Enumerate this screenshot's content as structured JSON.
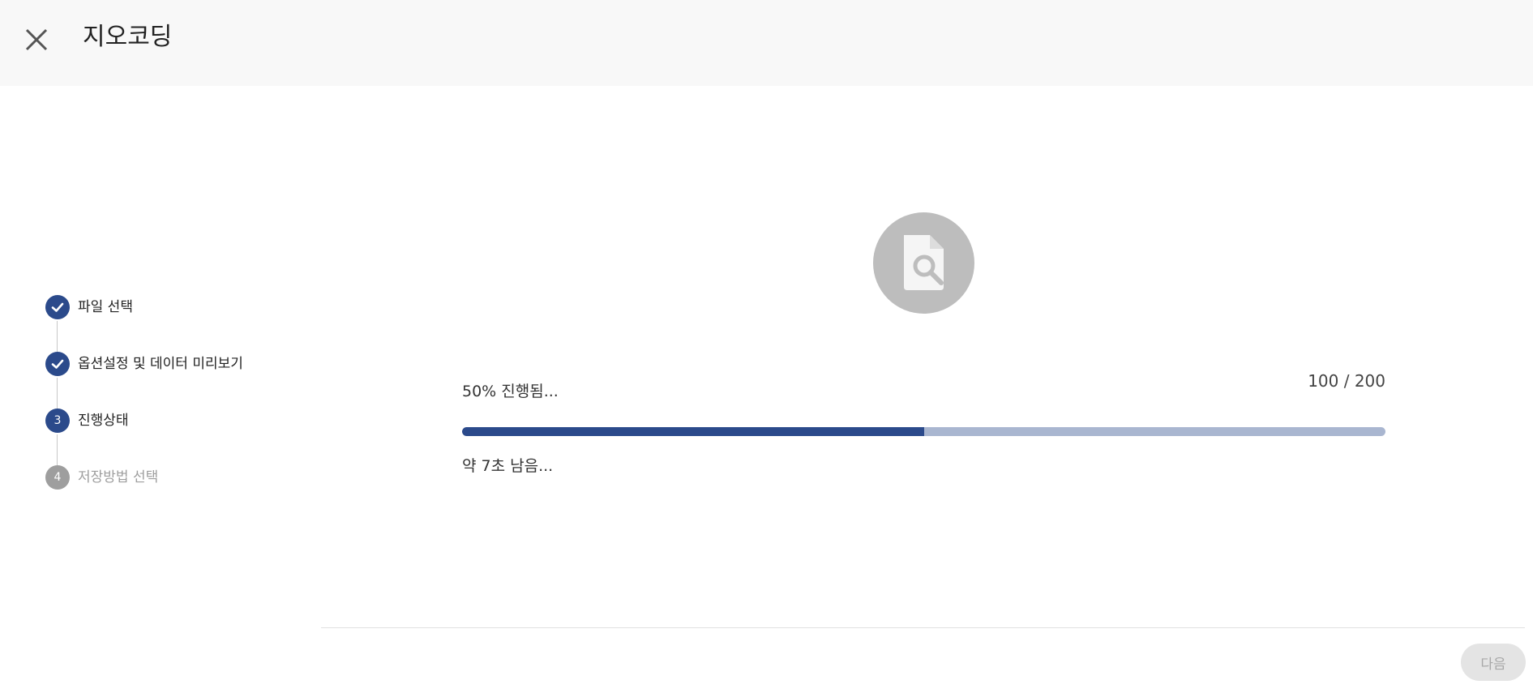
{
  "header": {
    "title": "지오코딩",
    "close_icon": "close-icon"
  },
  "steps": [
    {
      "status": "done",
      "marker": "",
      "label": "파일 선택"
    },
    {
      "status": "done",
      "marker": "",
      "label": "옵션설정 및 데이터 미리보기"
    },
    {
      "status": "current",
      "marker": "3",
      "label": "진행상태"
    },
    {
      "status": "pending",
      "marker": "4",
      "label": "저장방법 선택"
    }
  ],
  "progress": {
    "icon": "file-search-icon",
    "percent_text": "50%",
    "status_text": "진행됨...",
    "count": "100 / 200",
    "fraction": 0.5,
    "remaining": "약 7초 남음..."
  },
  "footer": {
    "next_label": "다음"
  },
  "colors": {
    "primary": "#2b4a8b",
    "track": "#a9b6d0",
    "pending": "#9e9e9e",
    "header_bg": "#f8f8f8"
  }
}
